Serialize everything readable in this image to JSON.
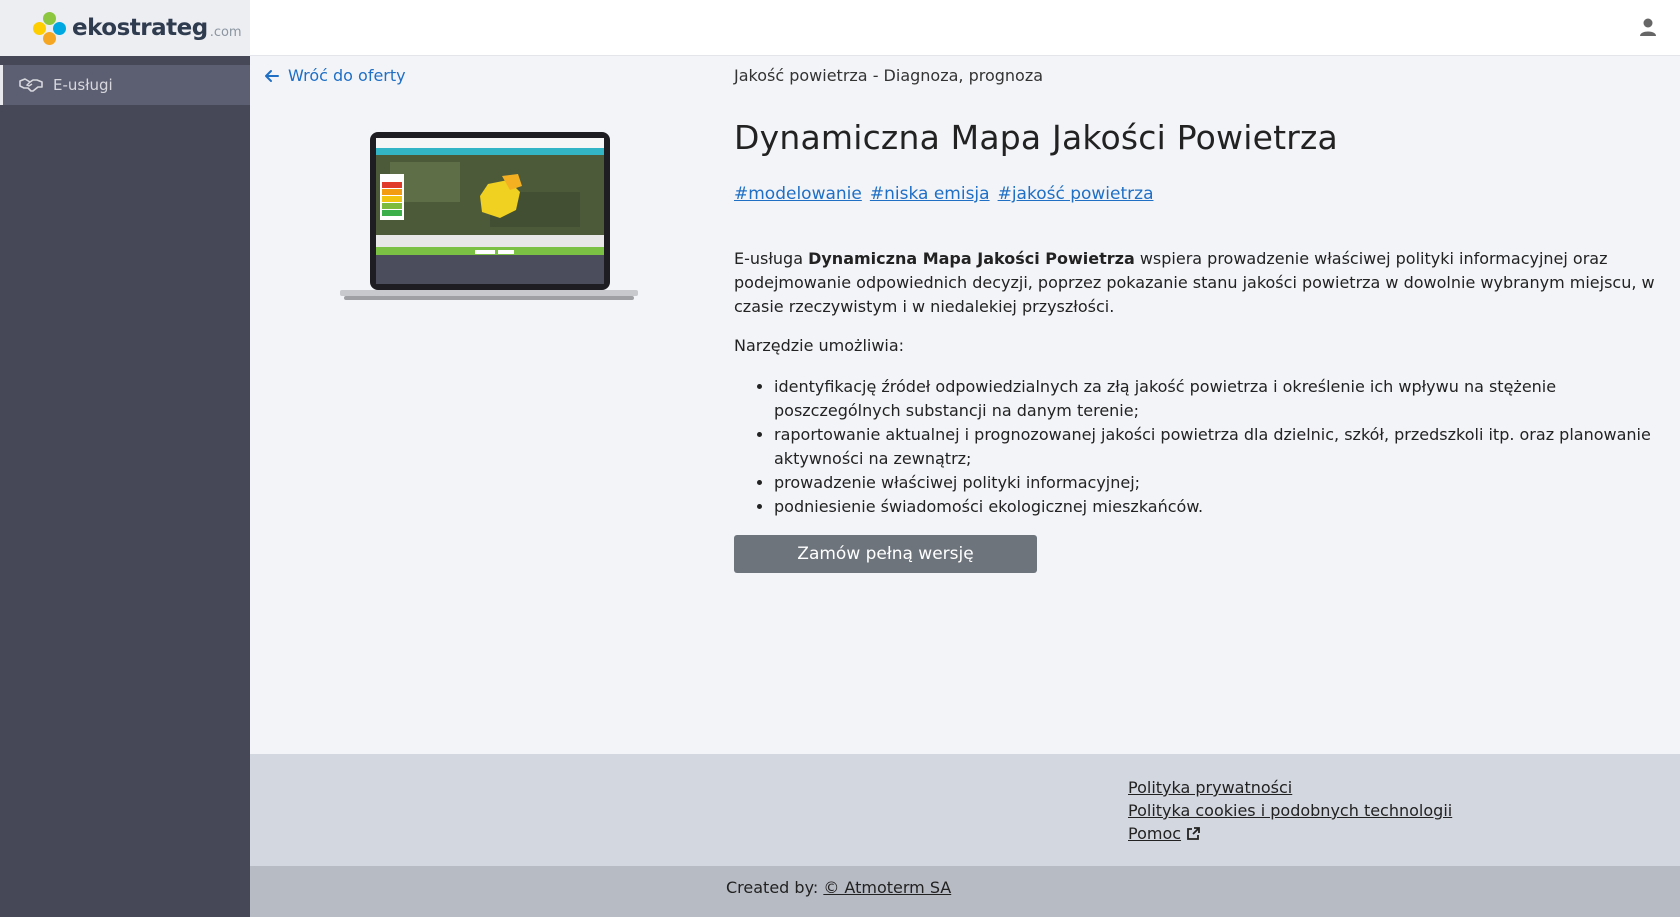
{
  "brand": {
    "name": "ekostrateg",
    "suffix": ".com"
  },
  "sidebar": {
    "items": [
      {
        "label": "E-usługi",
        "icon": "handshake-icon"
      }
    ]
  },
  "header": {
    "user_icon": "user-icon"
  },
  "main": {
    "back_label": "Wróć do oferty",
    "breadcrumb": "Jakość powietrza - Diagnoza, prognoza",
    "title": "Dynamiczna Mapa Jakości Powietrza",
    "tags": [
      "#modelowanie",
      "#niska emisja",
      "#jakość powietrza"
    ],
    "description": {
      "prefix": "E-usługa ",
      "bold": "Dynamiczna Mapa Jakości Powietrza",
      "suffix": " wspiera prowadzenie właściwej polityki informacyjnej oraz podejmowanie odpowiednich decyzji, poprzez pokazanie stanu jakości powietrza w dowolnie wybranym miejscu, w czasie rzeczywistym i w niedalekiej przyszłości."
    },
    "tool_intro": "Narzędzie umożliwia:",
    "features": [
      "identyfikację źródeł odpowiedzialnych za złą jakość powietrza i określenie ich wpływu na stężenie poszczególnych substancji na danym terenie;",
      "raportowanie aktualnej i prognozowanej jakości powietrza dla dzielnic, szkół, przedszkoli itp. oraz planowanie aktywności na zewnątrz;",
      "prowadzenie właściwej polityki informacyjnej;",
      "podniesienie świadomości ekologicznej mieszkańców."
    ],
    "order_button": "Zamów pełną wersję"
  },
  "footer": {
    "links": [
      "Polityka prywatności",
      "Polityka cookies i podobnych technologii",
      "Pomoc"
    ],
    "credits_prefix": "Created by: ",
    "credits_link": "© Atmoterm SA"
  },
  "colors": {
    "sidebar_bg": "#474857",
    "link": "#1f6fc5",
    "button_bg": "#6d747c",
    "footer_top": "#d3d7df",
    "footer_bottom": "#b7bbc4"
  }
}
